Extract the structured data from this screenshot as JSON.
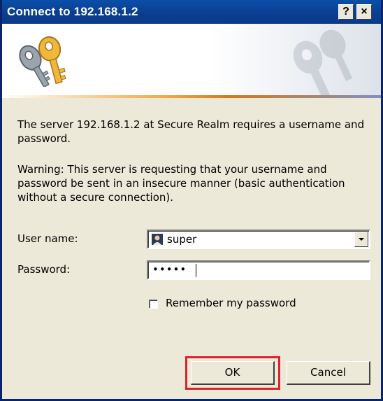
{
  "window": {
    "title": "Connect to 192.168.1.2",
    "help_button": "?",
    "close_button": "×"
  },
  "banner": {
    "icon": "keys-icon",
    "watermark": "keys-watermark-icon",
    "accent_color": "#e9a640"
  },
  "message": {
    "line1": "The server 192.168.1.2 at Secure Realm requires a username and password.",
    "warning": "Warning: This server is requesting that your username and password be sent in an insecure manner (basic authentication without a secure connection)."
  },
  "form": {
    "username_label": "User name:",
    "username_value": "super",
    "username_icon": "user-icon",
    "password_label": "Password:",
    "password_value": "•••••",
    "remember_label": "Remember my password",
    "remember_checked": false
  },
  "buttons": {
    "ok": "OK",
    "cancel": "Cancel"
  },
  "highlight": {
    "target": "ok-button",
    "color": "#d9232e"
  }
}
